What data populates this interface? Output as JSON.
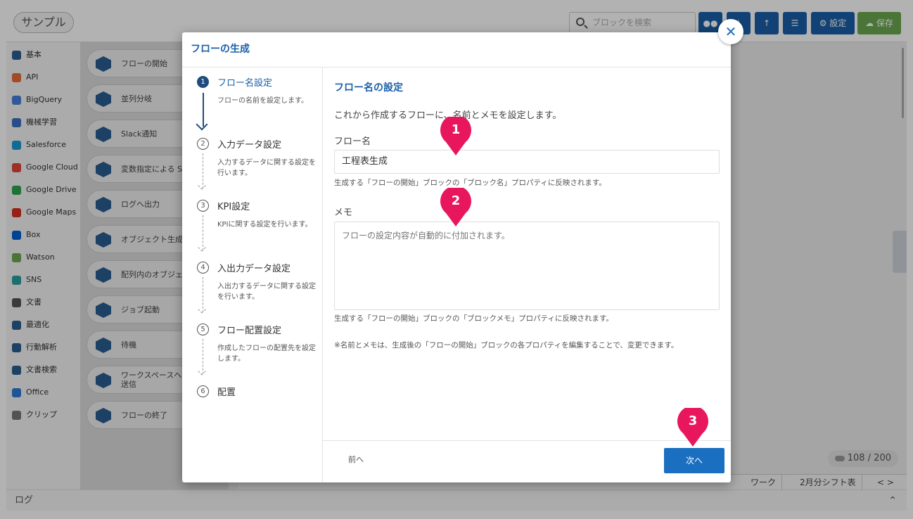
{
  "app": {
    "title": "サンプル",
    "search_placeholder": "ブロックを検索",
    "settings_label": "設定",
    "save_label": "保存"
  },
  "sidebar": {
    "items": [
      {
        "label": "基本",
        "color": "#2a5d91"
      },
      {
        "label": "API",
        "color": "#e86c3a"
      },
      {
        "label": "BigQuery",
        "color": "#4a7fd8"
      },
      {
        "label": "機械学習",
        "color": "#3a6fc4"
      },
      {
        "label": "Salesforce",
        "color": "#1a9ad6"
      },
      {
        "label": "Google Cloud",
        "color": "#e0473a"
      },
      {
        "label": "Google Drive",
        "color": "#2ca44f"
      },
      {
        "label": "Google Maps",
        "color": "#d93025"
      },
      {
        "label": "Box",
        "color": "#0061d5"
      },
      {
        "label": "Watson",
        "color": "#6aa84f"
      },
      {
        "label": "SNS",
        "color": "#2aa0a0"
      },
      {
        "label": "文書",
        "color": "#555555"
      },
      {
        "label": "最適化",
        "color": "#2a5d91"
      },
      {
        "label": "行動解析",
        "color": "#2a5d91"
      },
      {
        "label": "文書検索",
        "color": "#2a5d91"
      },
      {
        "label": "Office",
        "color": "#2a7ad8"
      },
      {
        "label": "クリップ",
        "color": "#777777"
      }
    ]
  },
  "blocks": [
    "フローの開始",
    "並列分岐",
    "Slack通知",
    "変数指定による S",
    "ログへ出力",
    "オブジェクト生成",
    "配列内のオブジェ 変換",
    "ジョブ起動",
    "待機",
    "ワークスペースへ ジを送信",
    "フローの終了"
  ],
  "tabs": [
    "ワーク",
    "2月分シフト表"
  ],
  "counter": "108 / 200",
  "log_label": "ログ",
  "modal": {
    "title": "フローの生成",
    "steps": [
      {
        "num": "1",
        "title": "フロー名設定",
        "desc": "フローの名前を設定します。"
      },
      {
        "num": "2",
        "title": "入力データ設定",
        "desc": "入力するデータに関する設定を行います。"
      },
      {
        "num": "3",
        "title": "KPI設定",
        "desc": "KPIに関する設定を行います。"
      },
      {
        "num": "4",
        "title": "入出力データ設定",
        "desc": "入出力するデータに関する設定を行います。"
      },
      {
        "num": "5",
        "title": "フロー配置設定",
        "desc": "作成したフローの配置先を設定します。"
      },
      {
        "num": "6",
        "title": "配置",
        "desc": ""
      }
    ],
    "section_title": "フロー名の設定",
    "intro": "これから作成するフローに、名前とメモを設定します。",
    "name_label": "フロー名",
    "name_value": "工程表生成",
    "name_hint": "生成する「フローの開始」ブロックの「ブロック名」プロパティに反映されます。",
    "memo_label": "メモ",
    "memo_placeholder": "フローの設定内容が自動的に付加されます。",
    "memo_hint": "生成する「フローの開始」ブロックの「ブロックメモ」プロパティに反映されます。",
    "note": "※名前とメモは、生成後の「フローの開始」ブロックの各プロパティを編集することで、変更できます。",
    "prev_label": "前へ",
    "next_label": "次へ"
  },
  "markers": [
    "1",
    "2",
    "3"
  ],
  "colors": {
    "accent": "#1a5fa8",
    "marker": "#e8175d",
    "save": "#6aa84f"
  }
}
